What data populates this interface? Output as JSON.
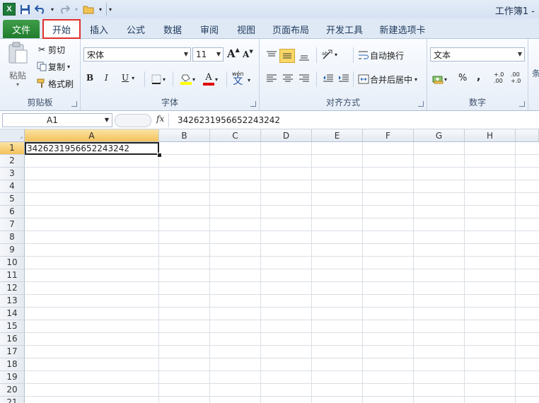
{
  "window": {
    "title": "工作簿1 -"
  },
  "tabs": {
    "file": "文件",
    "items": [
      "开始",
      "插入",
      "公式",
      "数据",
      "审阅",
      "视图",
      "页面布局",
      "开发工具",
      "新建选项卡"
    ]
  },
  "clipboard": {
    "paste": "粘贴",
    "cut": "剪切",
    "copy": "复制",
    "format_painter": "格式刷",
    "label": "剪贴板"
  },
  "font": {
    "name": "宋体",
    "size": "11",
    "grow": "A",
    "shrink": "A",
    "bold": "B",
    "italic": "I",
    "underline": "U",
    "label": "字体",
    "wen": "wén",
    "wen_char": "文"
  },
  "alignment": {
    "wrap_text": "自动换行",
    "merge_center": "合并后居中",
    "label": "对齐方式"
  },
  "number": {
    "format": "文本",
    "percent": "%",
    "comma": ",",
    "inc_decimal": "+.0\n.00",
    "dec_decimal": ".00\n+.0",
    "label": "数字"
  },
  "styles": {
    "label_partial": "条"
  },
  "formula_bar": {
    "name_box": "A1",
    "fx": "fx",
    "value": "3426231956652243242"
  },
  "sheet": {
    "columns": [
      "A",
      "B",
      "C",
      "D",
      "E",
      "F",
      "G",
      "H"
    ],
    "rows": [
      "1",
      "2",
      "3",
      "4",
      "5",
      "6",
      "7",
      "8",
      "9",
      "10",
      "11",
      "12",
      "13",
      "14",
      "15",
      "16",
      "17",
      "18",
      "19",
      "20",
      "21"
    ],
    "cells": {
      "A1": "3426231956652243242"
    }
  }
}
